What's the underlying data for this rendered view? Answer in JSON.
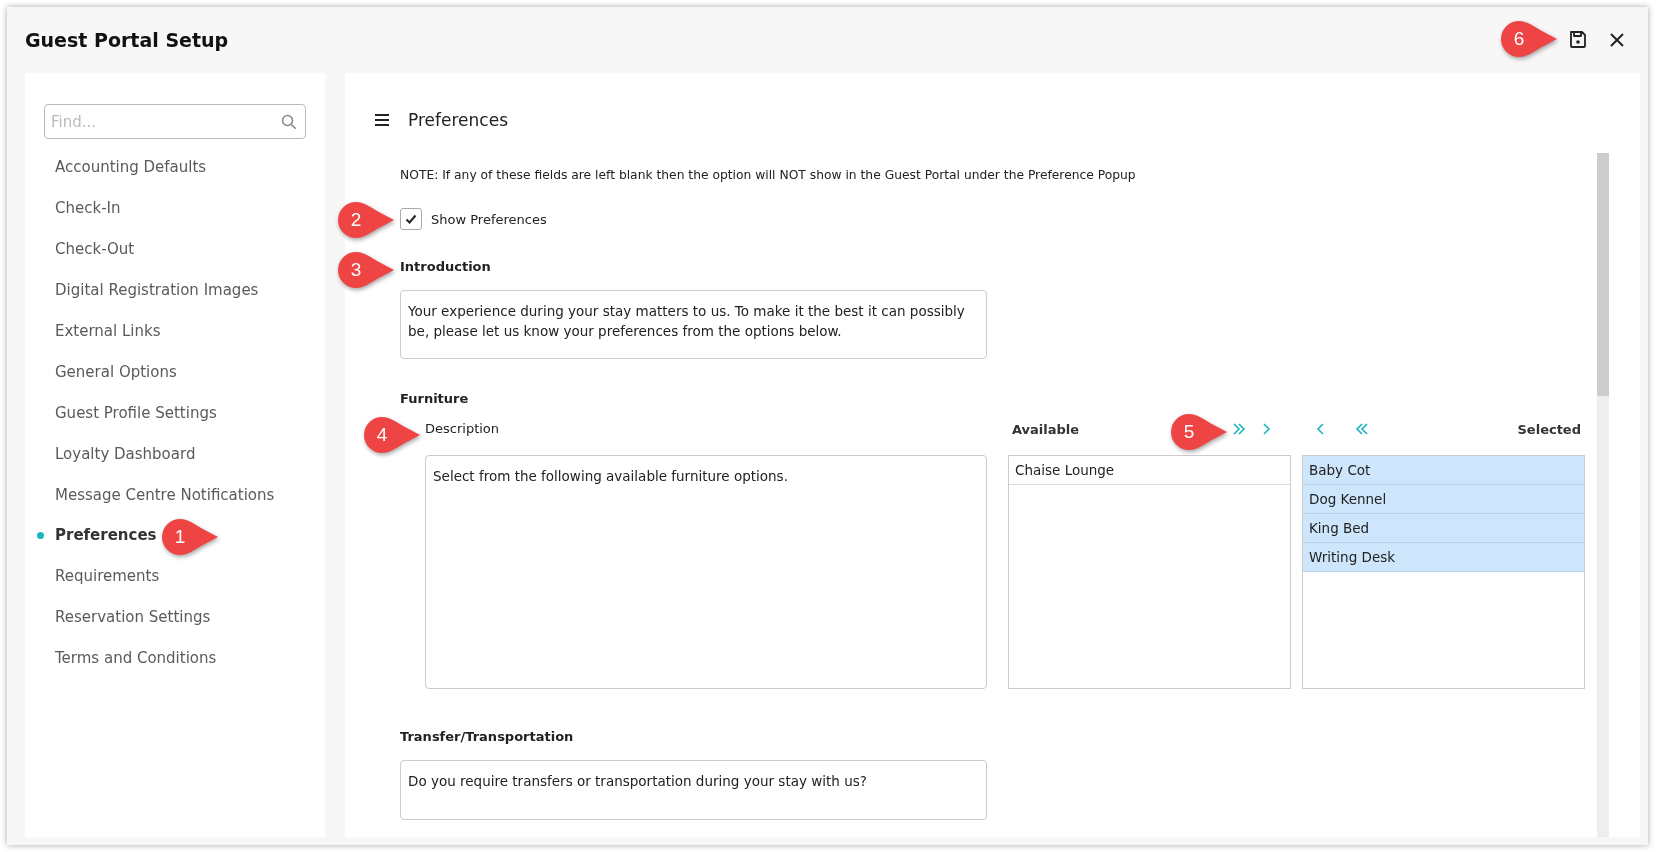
{
  "window": {
    "title": "Guest Portal Setup"
  },
  "sidebar": {
    "search": {
      "placeholder": "Find..."
    },
    "items": [
      {
        "label": "Accounting Defaults",
        "selected": false
      },
      {
        "label": "Check-In",
        "selected": false
      },
      {
        "label": "Check-Out",
        "selected": false
      },
      {
        "label": "Digital Registration Images",
        "selected": false
      },
      {
        "label": "External Links",
        "selected": false
      },
      {
        "label": "General Options",
        "selected": false
      },
      {
        "label": "Guest Profile Settings",
        "selected": false
      },
      {
        "label": "Loyalty Dashboard",
        "selected": false
      },
      {
        "label": "Message Centre Notifications",
        "selected": false
      },
      {
        "label": "Preferences",
        "selected": true
      },
      {
        "label": "Requirements",
        "selected": false
      },
      {
        "label": "Reservation Settings",
        "selected": false
      },
      {
        "label": "Terms and Conditions",
        "selected": false
      }
    ]
  },
  "main": {
    "title": "Preferences",
    "note": "NOTE: If any of these fields are left blank then the option will NOT show in the Guest Portal under the Preference Popup",
    "show_preferences": {
      "label": "Show Preferences",
      "checked": true
    },
    "introduction": {
      "label": "Introduction",
      "value": "Your experience during your stay matters to us. To make it the best it can possibly be, please let us know your preferences from the options below."
    },
    "furniture": {
      "label": "Furniture",
      "description_label": "Description",
      "description": "Select from the following available furniture options.",
      "available_label": "Available",
      "selected_label": "Selected",
      "available": [
        "Chaise Lounge"
      ],
      "selected": [
        "Baby Cot",
        "Dog Kennel",
        "King Bed",
        "Writing Desk"
      ]
    },
    "transfer": {
      "label": "Transfer/Transportation",
      "value": "Do you require transfers or transportation during your stay with us?"
    }
  },
  "callouts": [
    "1",
    "2",
    "3",
    "4",
    "5",
    "6"
  ]
}
